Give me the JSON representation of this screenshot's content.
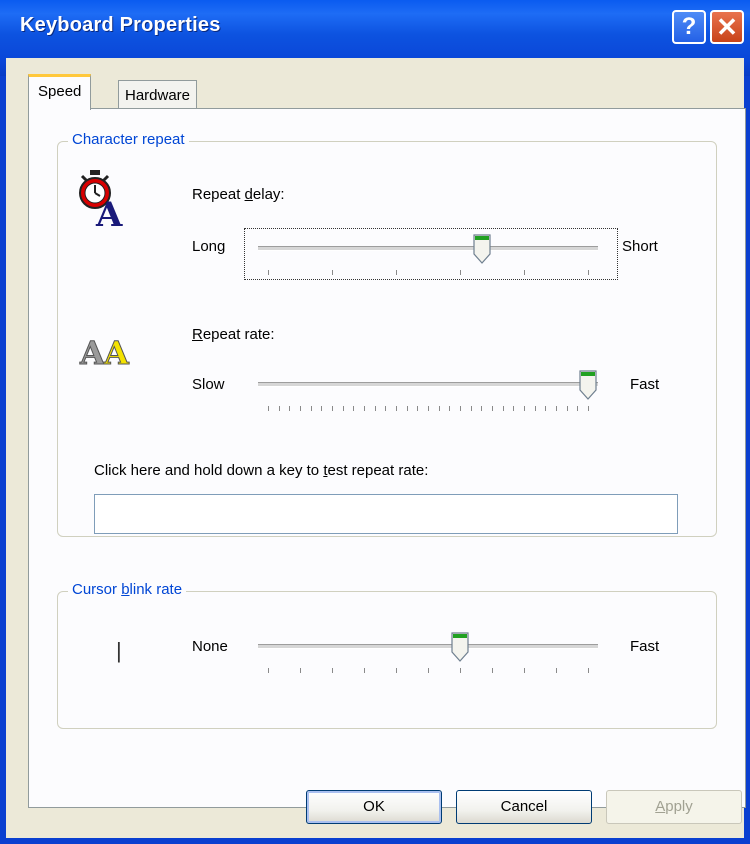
{
  "window": {
    "title": "Keyboard Properties",
    "help_glyph": "?",
    "close_glyph": "✕"
  },
  "tabs": [
    {
      "label": "Speed",
      "selected": true
    },
    {
      "label": "Hardware",
      "selected": false
    }
  ],
  "character_repeat": {
    "group_title": "Character repeat",
    "repeat_delay": {
      "label_pre": "Repeat ",
      "label_accel": "d",
      "label_post": "elay:",
      "min_label": "Long",
      "max_label": "Short",
      "value_fraction": 0.67
    },
    "repeat_rate": {
      "label_accel": "R",
      "label_post": "epeat rate:",
      "min_label": "Slow",
      "max_label": "Fast",
      "value_fraction": 1.0
    },
    "test_prompt_pre": "Click here and hold down a key to ",
    "test_prompt_accel": "t",
    "test_prompt_post": "est repeat rate:",
    "test_value": ""
  },
  "cursor_blink": {
    "group_title_pre": "Cursor ",
    "group_title_accel": "b",
    "group_title_post": "link rate",
    "min_label": "None",
    "max_label": "Fast",
    "value_fraction": 0.6,
    "preview_glyph": "|"
  },
  "buttons": {
    "ok": "OK",
    "cancel": "Cancel",
    "apply_accel": "A",
    "apply_post": "pply"
  }
}
